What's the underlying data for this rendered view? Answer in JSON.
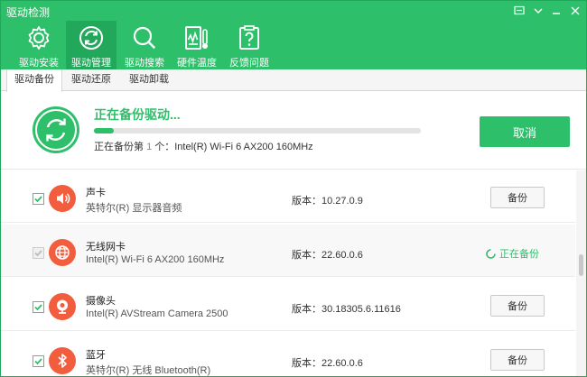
{
  "window": {
    "title": "驱动检测"
  },
  "toolbar": {
    "items": [
      {
        "label": "驱动安装",
        "icon": "gear-icon"
      },
      {
        "label": "驱动管理",
        "icon": "refresh-icon"
      },
      {
        "label": "驱动搜索",
        "icon": "search-icon"
      },
      {
        "label": "硬件温度",
        "icon": "thermometer-icon"
      },
      {
        "label": "反馈问题",
        "icon": "question-clipboard-icon"
      }
    ],
    "active_index": 1
  },
  "subtabs": [
    {
      "label": "驱动备份"
    },
    {
      "label": "驱动还原"
    },
    {
      "label": "驱动卸载"
    }
  ],
  "progress": {
    "title": "正在备份驱动...",
    "fraction": 0.06,
    "prefix": "正在备份第",
    "current": "1",
    "suffix": "个：Intel(R) Wi-Fi 6 AX200 160MHz",
    "cancel_label": "取消"
  },
  "drivers": [
    {
      "name": "声卡",
      "desc": "英特尔(R) 显示器音频",
      "version": "版本：10.27.0.9",
      "status": "button",
      "button_label": "备份",
      "icon": "speaker-icon",
      "checked": true
    },
    {
      "name": "无线网卡",
      "desc": "Intel(R) Wi-Fi 6 AX200 160MHz",
      "version": "版本：22.60.0.6",
      "status": "backing",
      "status_label": "正在备份",
      "icon": "globe-icon",
      "checked": true
    },
    {
      "name": "摄像头",
      "desc": "Intel(R) AVStream Camera 2500",
      "version": "版本：30.18305.6.11616",
      "status": "button",
      "button_label": "备份",
      "icon": "webcam-icon",
      "checked": true
    },
    {
      "name": "蓝牙",
      "desc": "英特尔(R) 无线 Bluetooth(R)",
      "version": "版本：22.60.0.6",
      "status": "button",
      "button_label": "备份",
      "icon": "bluetooth-icon",
      "checked": true
    }
  ],
  "colors": {
    "accent": "#2dbf6a",
    "icon_bg": "#f25d3e"
  }
}
